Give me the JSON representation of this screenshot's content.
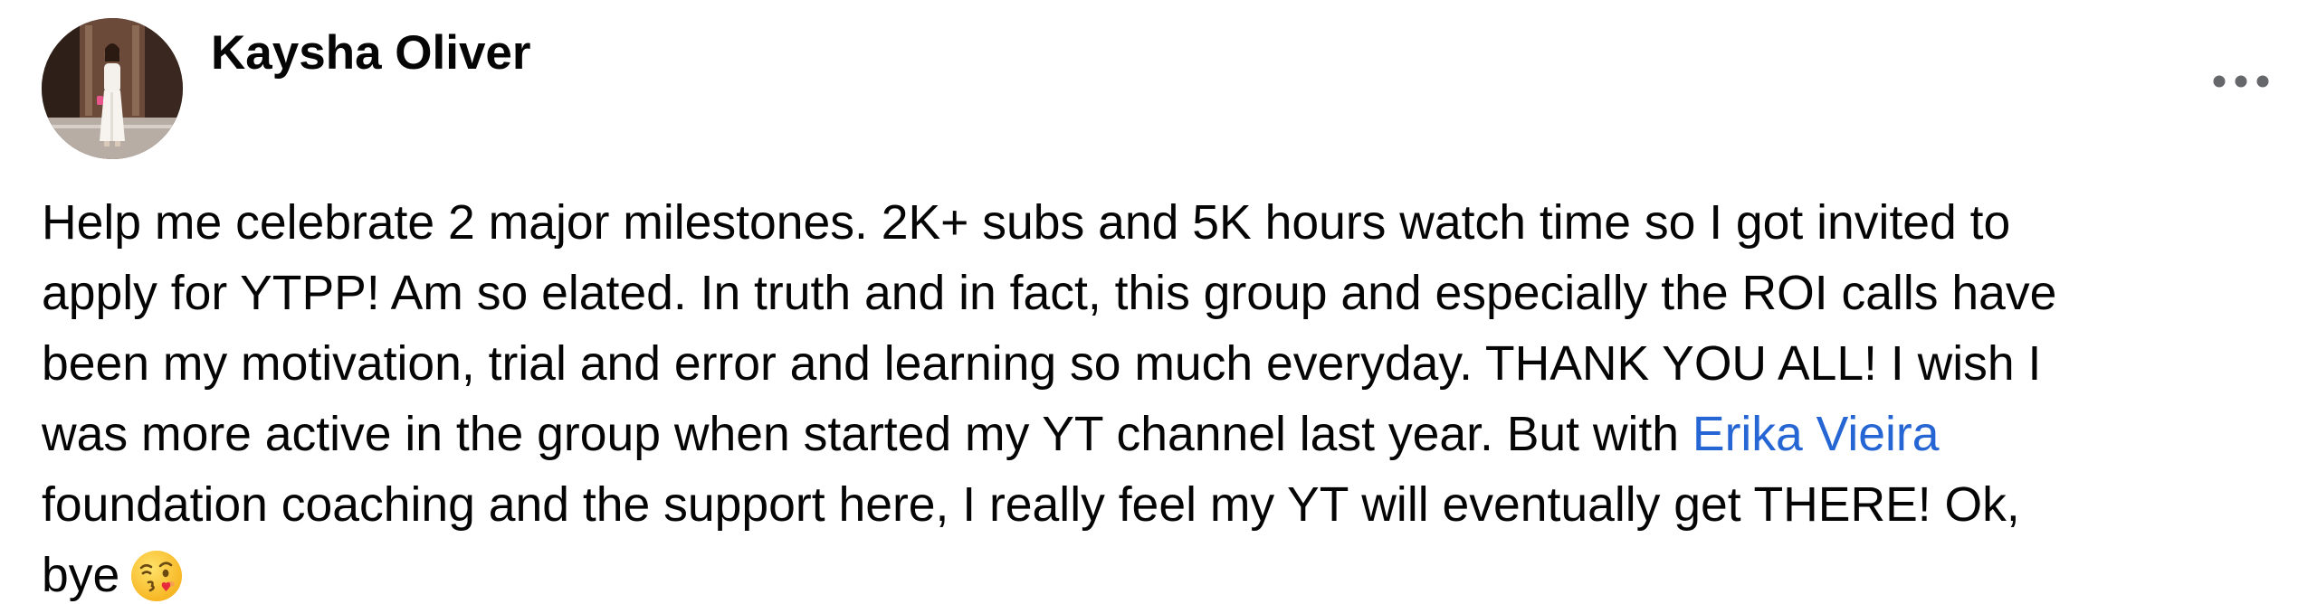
{
  "post": {
    "author": {
      "name": "Kaysha Oliver",
      "avatar_icon": "profile-photo"
    },
    "menu_icon": "more-horizontal-icon",
    "body": {
      "line1": "Help me celebrate 2 major milestones. 2K+ subs and 5K hours watch time so I got invited to",
      "line2": "apply for YTPP! Am so elated. In truth and in fact, this group and especially the ROI calls have",
      "line3": "been my motivation, trial and error and learning so much everyday. THANK YOU ALL! I wish I",
      "line4_before_mention": "was more active in the group when started my YT channel last year. But with ",
      "mention": "Erika Vieira",
      "line5": "foundation coaching and the support here, I really feel my YT will eventually get THERE! Ok,",
      "line6": "bye",
      "emoji": "face-blowing-a-kiss-emoji"
    },
    "colors": {
      "text": "#050505",
      "mention": "#2566d4",
      "menu_dots": "#65676b"
    }
  }
}
